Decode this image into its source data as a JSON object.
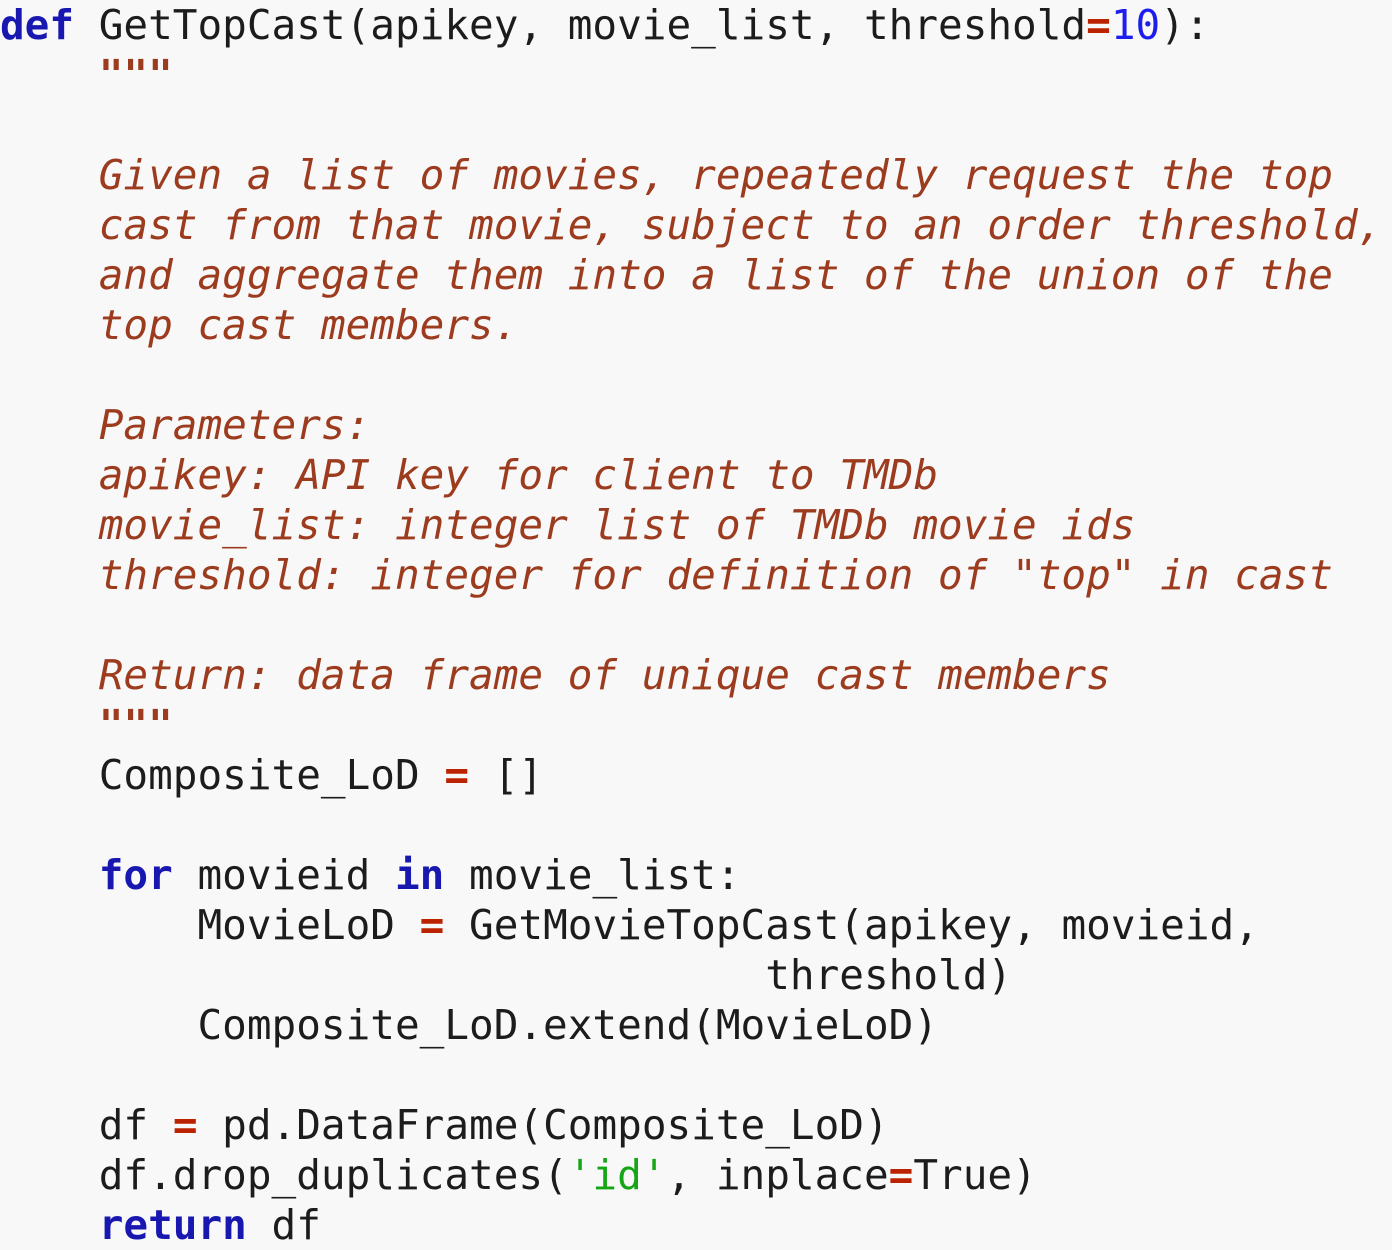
{
  "window": {
    "title": "GetTopCast",
    "language": "Python",
    "background_color": "#f8f8f8"
  },
  "theme": {
    "background": "#f8f8f8",
    "default_text": "#1c1c1c",
    "keyword": "#1818b0",
    "docstring": "#9c3b1e",
    "operator": "#bb2200",
    "number": "#1d1dee",
    "string": "#15a515"
  },
  "code": {
    "lines": [
      {
        "index": 1,
        "indent": 0,
        "tokens": [
          {
            "t": "def",
            "k": "kw"
          },
          {
            "t": " GetTopCast(apikey, movie_list, threshold",
            "k": "plain"
          },
          {
            "t": "=",
            "k": "op"
          },
          {
            "t": "10",
            "k": "num"
          },
          {
            "t": "):",
            "k": "plain"
          }
        ]
      },
      {
        "index": 2,
        "indent": 4,
        "tokens": [
          {
            "t": "\"\"\"",
            "k": "doc-quote"
          }
        ]
      },
      {
        "index": 3,
        "indent": 4,
        "tokens": []
      },
      {
        "index": 4,
        "indent": 4,
        "tokens": [
          {
            "t": "Given a list of movies, repeatedly request the top",
            "k": "doc"
          }
        ]
      },
      {
        "index": 5,
        "indent": 4,
        "tokens": [
          {
            "t": "cast from that movie, subject to an order threshold,",
            "k": "doc"
          }
        ]
      },
      {
        "index": 6,
        "indent": 4,
        "tokens": [
          {
            "t": "and aggregate them into a list of the union of the",
            "k": "doc"
          }
        ]
      },
      {
        "index": 7,
        "indent": 4,
        "tokens": [
          {
            "t": "top cast members.",
            "k": "doc"
          }
        ]
      },
      {
        "index": 8,
        "indent": 4,
        "tokens": []
      },
      {
        "index": 9,
        "indent": 4,
        "tokens": [
          {
            "t": "Parameters:",
            "k": "doc"
          }
        ]
      },
      {
        "index": 10,
        "indent": 4,
        "tokens": [
          {
            "t": "apikey: API key for client to TMDb",
            "k": "doc"
          }
        ]
      },
      {
        "index": 11,
        "indent": 4,
        "tokens": [
          {
            "t": "movie_list: integer list of TMDb movie ids",
            "k": "doc"
          }
        ]
      },
      {
        "index": 12,
        "indent": 4,
        "tokens": [
          {
            "t": "threshold: integer for definition of \"top\" in cast",
            "k": "doc"
          }
        ]
      },
      {
        "index": 13,
        "indent": 4,
        "tokens": []
      },
      {
        "index": 14,
        "indent": 4,
        "tokens": [
          {
            "t": "Return: data frame of unique cast members",
            "k": "doc"
          }
        ]
      },
      {
        "index": 15,
        "indent": 4,
        "tokens": [
          {
            "t": "\"\"\"",
            "k": "doc-quote"
          }
        ]
      },
      {
        "index": 16,
        "indent": 4,
        "tokens": [
          {
            "t": "Composite_LoD ",
            "k": "plain"
          },
          {
            "t": "=",
            "k": "op"
          },
          {
            "t": " []",
            "k": "plain"
          }
        ]
      },
      {
        "index": 17,
        "indent": 4,
        "tokens": []
      },
      {
        "index": 18,
        "indent": 4,
        "tokens": [
          {
            "t": "for",
            "k": "kw"
          },
          {
            "t": " movieid ",
            "k": "plain"
          },
          {
            "t": "in",
            "k": "kw"
          },
          {
            "t": " movie_list:",
            "k": "plain"
          }
        ]
      },
      {
        "index": 19,
        "indent": 8,
        "tokens": [
          {
            "t": "MovieLoD ",
            "k": "plain"
          },
          {
            "t": "=",
            "k": "op"
          },
          {
            "t": " GetMovieTopCast(apikey, movieid,",
            "k": "plain"
          }
        ]
      },
      {
        "index": 20,
        "indent": 31,
        "tokens": [
          {
            "t": "threshold)",
            "k": "plain"
          }
        ]
      },
      {
        "index": 21,
        "indent": 8,
        "tokens": [
          {
            "t": "Composite_LoD.extend(MovieLoD)",
            "k": "plain"
          }
        ]
      },
      {
        "index": 22,
        "indent": 4,
        "tokens": []
      },
      {
        "index": 23,
        "indent": 4,
        "tokens": [
          {
            "t": "df ",
            "k": "plain"
          },
          {
            "t": "=",
            "k": "op"
          },
          {
            "t": " pd.DataFrame(Composite_LoD)",
            "k": "plain"
          }
        ]
      },
      {
        "index": 24,
        "indent": 4,
        "tokens": [
          {
            "t": "df.drop_duplicates(",
            "k": "plain"
          },
          {
            "t": "'id'",
            "k": "sstr"
          },
          {
            "t": ", inplace",
            "k": "plain"
          },
          {
            "t": "=",
            "k": "op"
          },
          {
            "t": "True)",
            "k": "plain"
          }
        ]
      },
      {
        "index": 25,
        "indent": 4,
        "tokens": [
          {
            "t": "return",
            "k": "kw"
          },
          {
            "t": " df",
            "k": "plain"
          }
        ]
      }
    ],
    "plain_text": "def GetTopCast(apikey, movie_list, threshold=10):\n    \"\"\"\n    Given a list of movies, repeatedly request the top\n    cast from that movie, subject to an order threshold,\n    and aggregate them into a list of the union of the\n    top cast members.\n\n    Parameters:\n    apikey: API key for client to TMDb\n    movie_list: integer list of TMDb movie ids\n    threshold: integer for definition of \"top\" in cast\n\n    Return: data frame of unique cast members\n    \"\"\"\n    Composite_LoD = []\n\n    for movieid in movie_list:\n        MovieLoD = GetMovieTopCast(apikey, movieid,\n                               threshold)\n        Composite_LoD.extend(MovieLoD)\n\n    df = pd.DataFrame(Composite_LoD)\n    df.drop_duplicates('id', inplace=True)\n    return df"
  }
}
